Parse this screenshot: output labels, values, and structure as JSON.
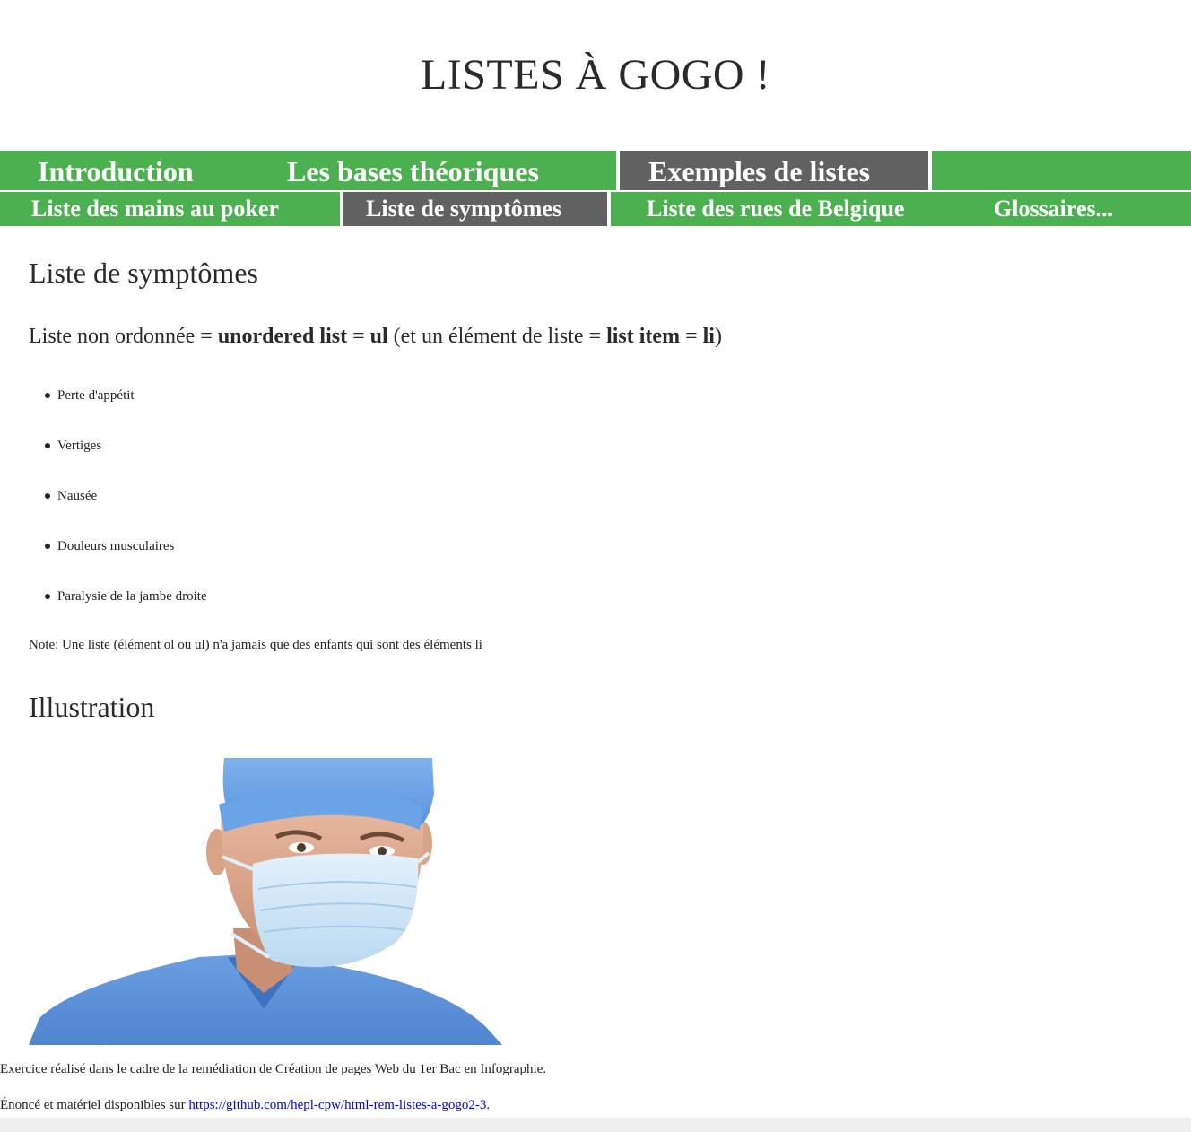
{
  "site": {
    "title": "LISTES À GOGO !"
  },
  "nav_main": {
    "items": [
      {
        "label": "Introduction"
      },
      {
        "label": "Les bases théoriques"
      },
      {
        "label": "Exemples de listes"
      }
    ]
  },
  "nav_sub": {
    "items": [
      {
        "label": "Liste des mains au poker"
      },
      {
        "label": "Liste de symptômes"
      },
      {
        "label": "Liste des rues de Belgique"
      },
      {
        "label": "Glossaires..."
      }
    ]
  },
  "colors": {
    "nav_green": "#4caf50",
    "nav_active": "#616161",
    "link": "#0000ee"
  },
  "main": {
    "heading": "Liste de symptômes",
    "intro": {
      "t1": "Liste non ordonnée = ",
      "b1": "unordered list",
      "t2": " = ",
      "b2": "ul",
      "t3": " (et un élément de liste = ",
      "b3": "list item",
      "t4": " = ",
      "b4": "li",
      "t5": ")"
    },
    "symptoms": [
      "Perte d'appétit",
      "Vertiges",
      "Nausée",
      "Douleurs musculaires",
      "Paralysie de la jambe droite"
    ],
    "note": "Note: Une liste (élément ol ou ul) n'a jamais que des enfants qui sont des éléments li",
    "illustration_heading": "Illustration"
  },
  "footer": {
    "line1": "Exercice réalisé dans le cadre de la remédiation de Création de pages Web du 1er Bac en Infographie.",
    "line2_prefix": "Énoncé et matériel disponibles sur ",
    "line2_link": "https://github.com/hepl-cpw/html-rem-listes-a-gogo2-3",
    "line2_suffix": "."
  }
}
